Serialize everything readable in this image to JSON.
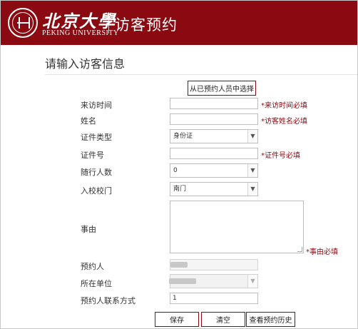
{
  "header": {
    "logo_cn": "北京大學",
    "logo_en": "PEKING UNIVERSITY",
    "title": "访客预约"
  },
  "section_title": "请输入访客信息",
  "select_from_booker_button": "从已预约人员中选择",
  "form": {
    "visit_time": {
      "label": "来访时间",
      "value": "",
      "required": "*来访时间必填"
    },
    "name": {
      "label": "姓名",
      "value": "",
      "required": "*访客姓名必填"
    },
    "id_type": {
      "label": "证件类型",
      "value": "身份证"
    },
    "id_number": {
      "label": "证件号",
      "value": "",
      "required": "*证件号必填"
    },
    "companions": {
      "label": "随行人数",
      "value": "0"
    },
    "campus_gate": {
      "label": "入校校门",
      "value": "南门"
    },
    "reason": {
      "label": "事由",
      "value": "",
      "required": "*事由必填"
    },
    "booker": {
      "label": "预约人"
    },
    "unit": {
      "label": "所在单位"
    },
    "booker_contact": {
      "label": "预约人联系方式",
      "value": "1"
    }
  },
  "buttons": {
    "save": "保存",
    "clear": "清空",
    "history": "查看预约历史"
  },
  "colors": {
    "brand": "#8b0a12",
    "required_text": "#8b0a12"
  }
}
